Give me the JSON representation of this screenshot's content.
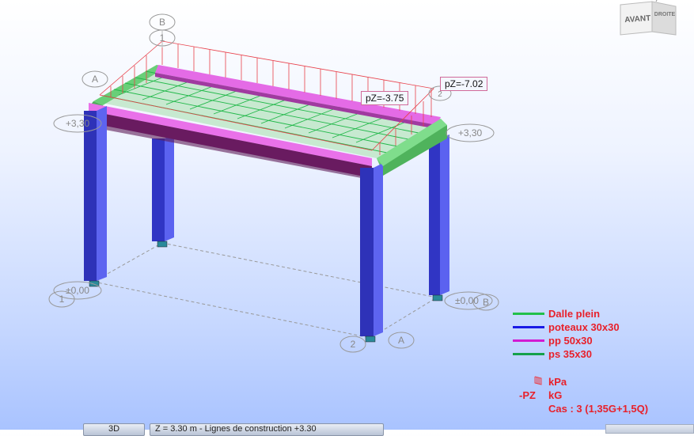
{
  "viewcube": {
    "front_label": "AVANT",
    "right_label": "DROITE"
  },
  "grid_labels": {
    "axis_b_top": "B",
    "axis_1_top": "1",
    "axis_a_left": "A",
    "level_left_top": "+3,30",
    "level_right_top": "+3,30",
    "level_left_bottom": "±0,00",
    "level_right_bottom": "±0,00",
    "axis_1_bottom": "1",
    "axis_2_bottom": "2",
    "axis_a_bottom": "A",
    "axis_b_right": "B",
    "axis_2_top": "2"
  },
  "annotations": {
    "pz_left": "pZ=-3.75",
    "pz_right": "pZ=-7.02"
  },
  "legend": {
    "items": [
      {
        "label": "Dalle plein",
        "color": "#22c04a"
      },
      {
        "label": "poteaux 30x30",
        "color": "#1a1ae6"
      },
      {
        "label": "pp 50x30",
        "color": "#d21ad2"
      },
      {
        "label": "ps 35x30",
        "color": "#15a04a"
      }
    ]
  },
  "units": {
    "load_unit": "kPa",
    "force_key": "-PZ",
    "force_unit": "kG",
    "case_label": "Cas : 3 (1,35G+1,5Q)"
  },
  "bottom_bar": {
    "tab_3d": "3D",
    "tab_level": "Z = 3.30 m - Lignes de construction +3.30"
  },
  "colors": {
    "columns": "#3f45d8",
    "main_beam": "#e46be6",
    "secondary_beam": "#6cd47a",
    "slab_mesh": "#2fbf4f",
    "load_lines": "#e8404a"
  }
}
